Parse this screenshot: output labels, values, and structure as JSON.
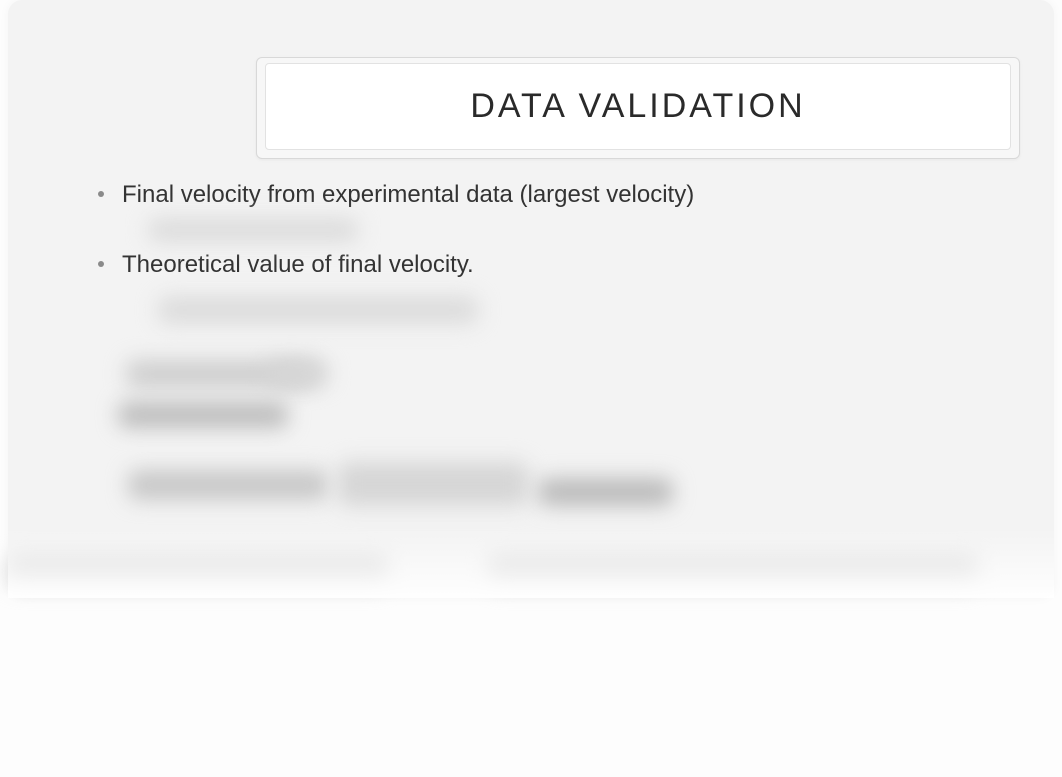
{
  "title": "DATA VALIDATION",
  "bullets": [
    {
      "text": "Final velocity from experimental data (largest velocity)"
    },
    {
      "text": "Theoretical value of final velocity."
    }
  ]
}
